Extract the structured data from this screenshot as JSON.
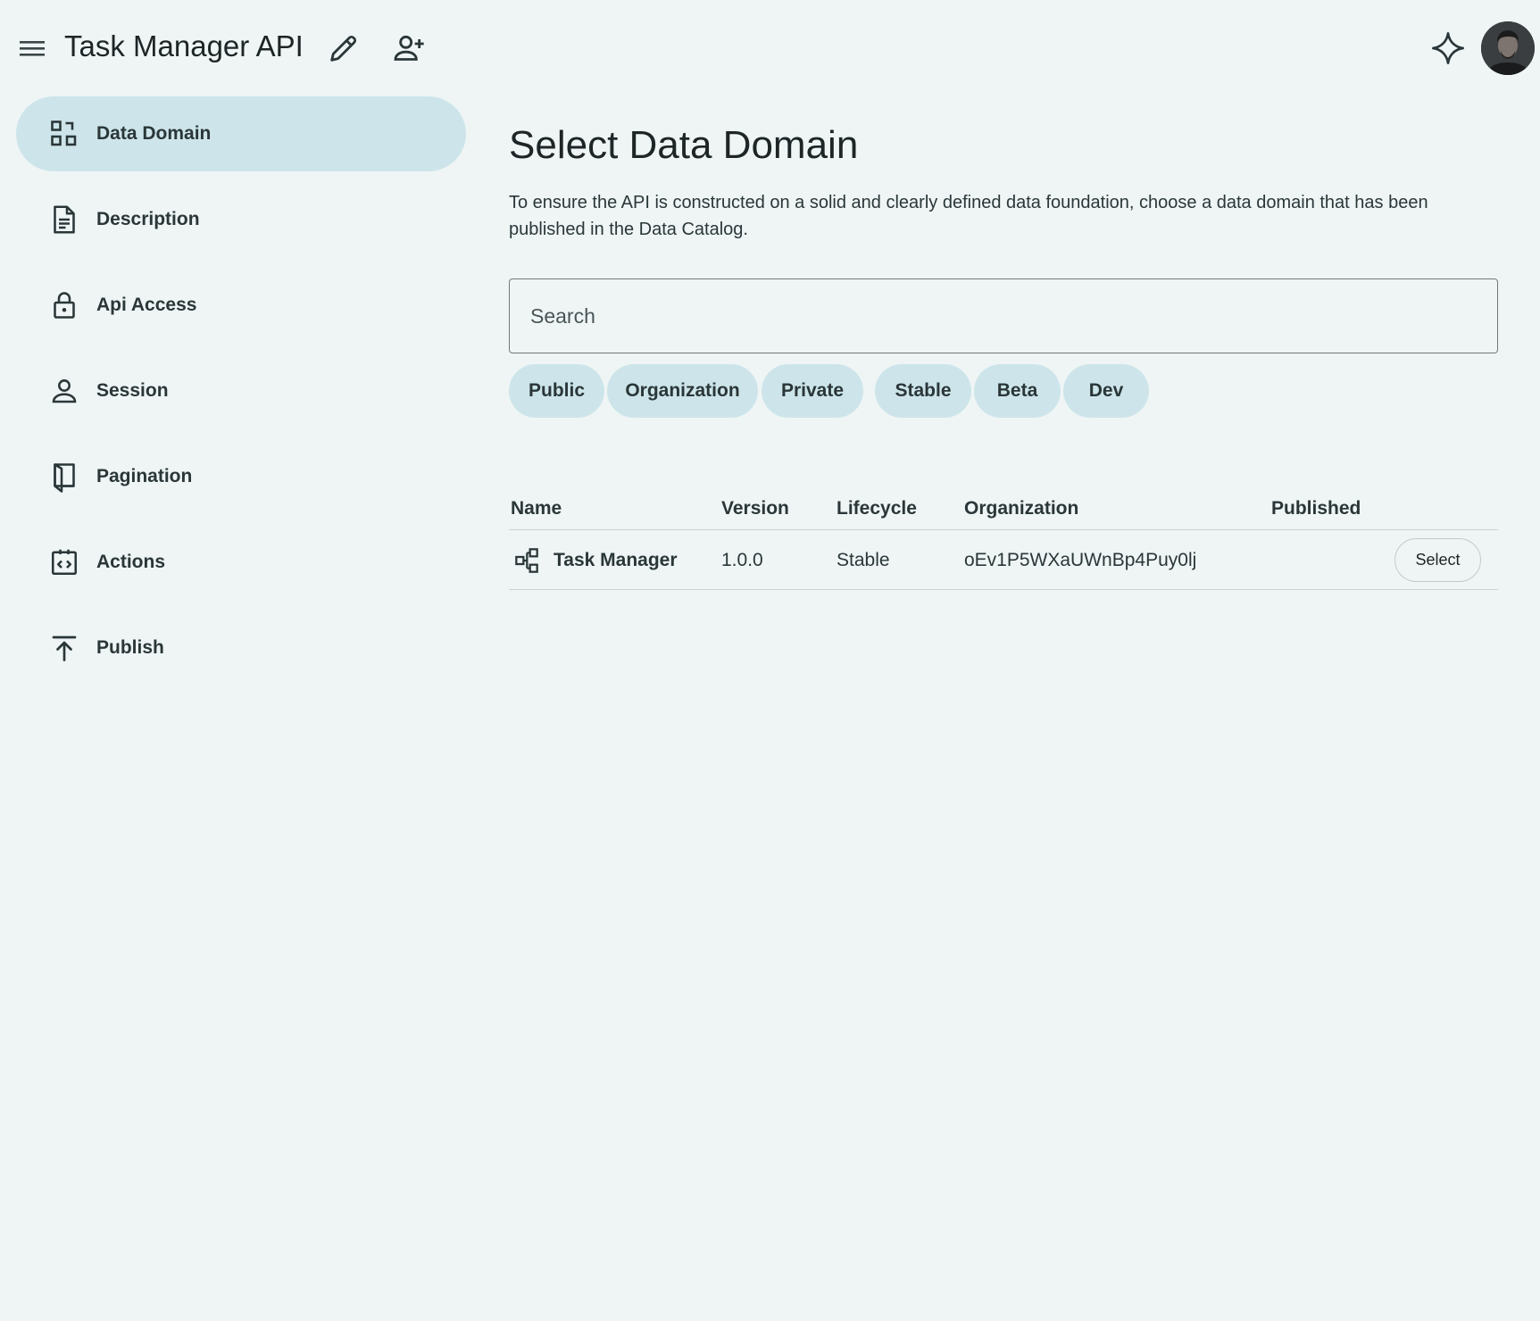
{
  "app": {
    "title": "Task Manager API",
    "icons": [
      "menu-icon",
      "edit-icon",
      "person-add-icon",
      "sparkle-icon"
    ]
  },
  "sidebar": {
    "items": [
      {
        "label": "Data Domain",
        "icon": "data-domain-icon",
        "active": true
      },
      {
        "label": "Description",
        "icon": "document-icon"
      },
      {
        "label": "Api Access",
        "icon": "lock-icon"
      },
      {
        "label": "Session",
        "icon": "person-icon"
      },
      {
        "label": "Pagination",
        "icon": "book-icon"
      },
      {
        "label": "Actions",
        "icon": "code-icon"
      },
      {
        "label": "Publish",
        "icon": "upload-icon"
      }
    ]
  },
  "main": {
    "title": "Select Data Domain",
    "description": "To ensure the API is constructed on a solid and clearly defined data foundation, choose a data domain that has been published in the Data Catalog.",
    "search": {
      "placeholder": "Search",
      "value": ""
    },
    "filters": [
      "Public",
      "Organization",
      "Private",
      "Stable",
      "Beta",
      "Dev"
    ],
    "table": {
      "columns": [
        "Name",
        "Version",
        "Lifecycle",
        "Organization",
        "Published"
      ],
      "rows": [
        {
          "name": "Task Manager",
          "version": "1.0.0",
          "lifecycle": "Stable",
          "organization": "oEv1P5WXaUWnBp4Puy0lj",
          "published": "",
          "action": "Select"
        }
      ]
    }
  },
  "colors": {
    "background": "#eff5f5",
    "accent": "#cde5ea",
    "text": "#1d2526"
  }
}
